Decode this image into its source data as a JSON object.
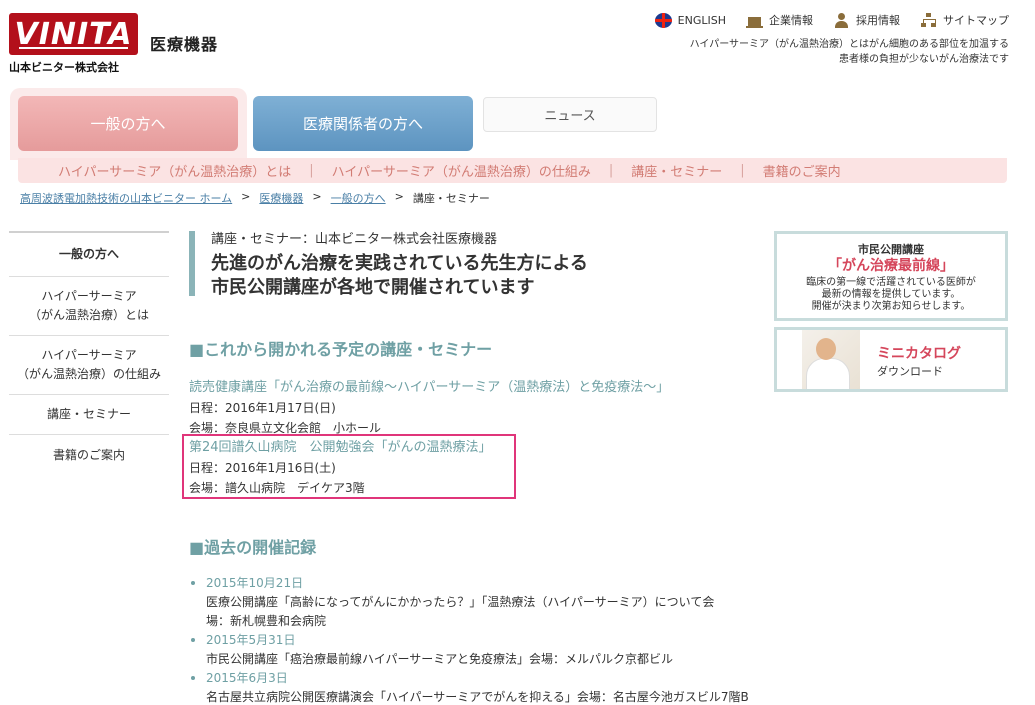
{
  "header": {
    "logo": "VINITA",
    "logo_sub": "医療機器",
    "company": "山本ビニター株式会社",
    "top_links": [
      {
        "label": "ENGLISH",
        "icon": "uk-flag-icon"
      },
      {
        "label": "企業情報",
        "icon": "building-icon"
      },
      {
        "label": "採用情報",
        "icon": "person-icon"
      },
      {
        "label": "サイトマップ",
        "icon": "sitemap-icon"
      }
    ],
    "tagline_1": "ハイパーサーミア（がん温熱治療）とはがん細胞のある部位を加温する",
    "tagline_2": "患者様の負担が少ないがん治療法です"
  },
  "tabs": {
    "general": "一般の方へ",
    "medical": "医療関係者の方へ",
    "news": "ニュース"
  },
  "subnav": [
    "ハイパーサーミア（がん温熱治療）とは",
    "ハイパーサーミア（がん温熱治療）の仕組み",
    "講座・セミナー",
    "書籍のご案内"
  ],
  "breadcrumb": {
    "home": "高周波誘電加熱技術の山本ビニター ホーム",
    "medical": "医療機器",
    "general": "一般の方へ",
    "current": "講座・セミナー",
    "sep": ">"
  },
  "leftnav": {
    "active": "一般の方へ",
    "item1_l1": "ハイパーサーミア",
    "item1_l2": "（がん温熱治療）とは",
    "item2_l1": "ハイパーサーミア",
    "item2_l2": "（がん温熱治療）の仕組み",
    "item3": "講座・セミナー",
    "item4": "書籍のご案内"
  },
  "main": {
    "title_sub": "講座・セミナー：山本ビニター株式会社医療機器",
    "title_l1": "先進のがん治療を実践されている先生方による",
    "title_l2": "市民公開講座が各地で開催されています",
    "upcoming_head": "■これから開かれる予定の講座・セミナー",
    "ev1_title": "読売健康講座「がん治療の最前線〜ハイパーサーミア（温熱療法）と免疫療法〜」",
    "ev1_date": "日程：2016年1月17日(日)",
    "ev1_venue": "会場：奈良県立文化会館　小ホール",
    "ev2_title": "第24回譜久山病院　公開勉強会「がんの温熱療法」",
    "ev2_date": "日程：2016年1月16日(土)",
    "ev2_venue": "会場：譜久山病院　デイケア3階",
    "past_head": "■過去の開催記録",
    "past": [
      {
        "date": "2015年10月21日",
        "text_1": "医療公開講座「高齢になってがんにかかったら？」「温熱療法（ハイパーサーミア）について会",
        "text_2": "場：新札幌豊和会病院"
      },
      {
        "date": "2015年5月31日",
        "text_1": "市民公開講座「癌治療最前線ハイパーサーミアと免疫療法」会場：メルパルク京都ビル"
      },
      {
        "date": "2015年6月3日",
        "text_1": "名古屋共立病院公開医療講演会「ハイパーサーミアでがんを抑える」会場：名古屋今池ガスビル7階B"
      }
    ]
  },
  "side": {
    "card1_title": "市民公開講座",
    "card1_head": "「がん治療最前線」",
    "card1_d1": "臨床の第一線で活躍されている医師が",
    "card1_d2": "最新の情報を提供しています。",
    "card1_d3": "開催が決まり次第お知らせします。",
    "card2_head": "ミニカタログ",
    "card2_sub": "ダウンロード"
  }
}
